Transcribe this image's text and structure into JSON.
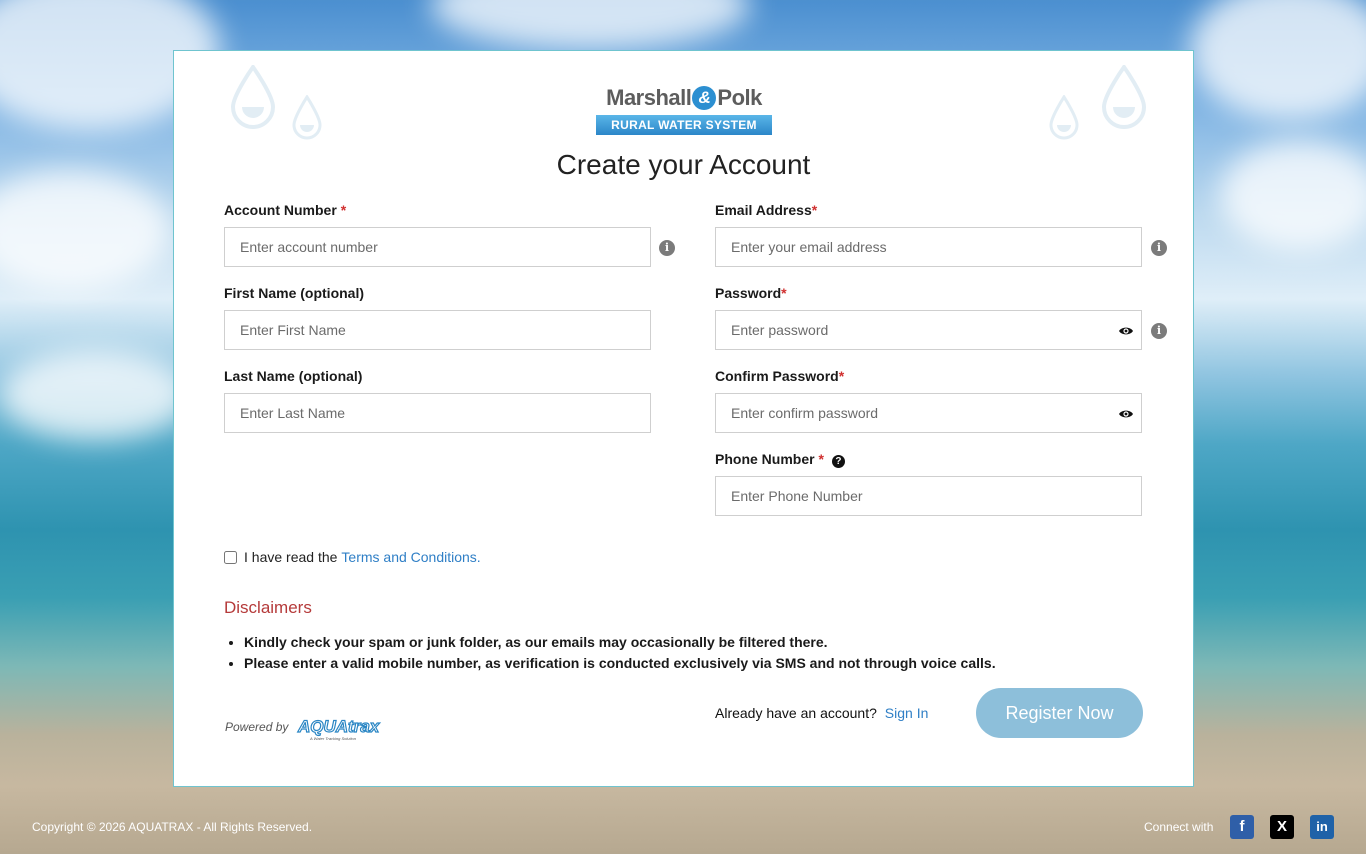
{
  "logo": {
    "brand_left": "Marshall",
    "brand_amp": "&",
    "brand_right": "Polk",
    "tagline": "RURAL WATER SYSTEM"
  },
  "page_title": "Create your Account",
  "form": {
    "account_number": {
      "label": "Account Number",
      "required_mark": "*",
      "placeholder": "Enter account number",
      "value": ""
    },
    "email": {
      "label": "Email Address",
      "required_mark": "*",
      "placeholder": "Enter your email address",
      "value": ""
    },
    "first_name": {
      "label": "First Name (optional)",
      "placeholder": "Enter First Name",
      "value": ""
    },
    "password": {
      "label": "Password",
      "required_mark": "*",
      "placeholder": "Enter password",
      "value": ""
    },
    "last_name": {
      "label": "Last Name (optional)",
      "placeholder": "Enter Last Name",
      "value": ""
    },
    "confirm_password": {
      "label": "Confirm Password",
      "required_mark": "*",
      "placeholder": "Enter confirm password",
      "value": ""
    },
    "phone": {
      "label": "Phone Number",
      "required_mark": "*",
      "placeholder": "Enter Phone Number",
      "value": ""
    }
  },
  "icons": {
    "info": "info-circle-icon",
    "eye": "eye-icon",
    "help": "question-circle-icon",
    "info_glyph": "i",
    "help_glyph": "?"
  },
  "terms": {
    "prefix": "I have read the",
    "link": "Terms and Conditions.",
    "checked": false
  },
  "disclaimers": {
    "title": "Disclaimers",
    "items": [
      "Kindly check your spam or junk folder, as our emails may occasionally be filtered there.",
      "Please enter a valid mobile number, as verification is conducted exclusively via SMS and not through voice calls."
    ]
  },
  "powered_by": {
    "label": "Powered by",
    "logo_text": "AQUAtrax",
    "logo_sub": "A Water Tracking Solution"
  },
  "signin": {
    "prompt": "Already have an account?",
    "link": "Sign In"
  },
  "register_button": "Register Now",
  "footer": {
    "copyright": "Copyright © 2026 AQUATRAX - All Rights Reserved.",
    "connect": "Connect with",
    "social": [
      {
        "name": "facebook",
        "glyph": "f",
        "color": "#2f5fa8"
      },
      {
        "name": "x",
        "glyph": "X",
        "color": "#000000"
      },
      {
        "name": "linkedin",
        "glyph": "in",
        "color": "#1f62a8"
      }
    ]
  },
  "colors": {
    "accent": "#2f7fc6",
    "required": "#d0302f",
    "disclaimer_title": "#b53a3a",
    "register_button": "#8dbfda",
    "card_border": "#6fc4cf"
  }
}
